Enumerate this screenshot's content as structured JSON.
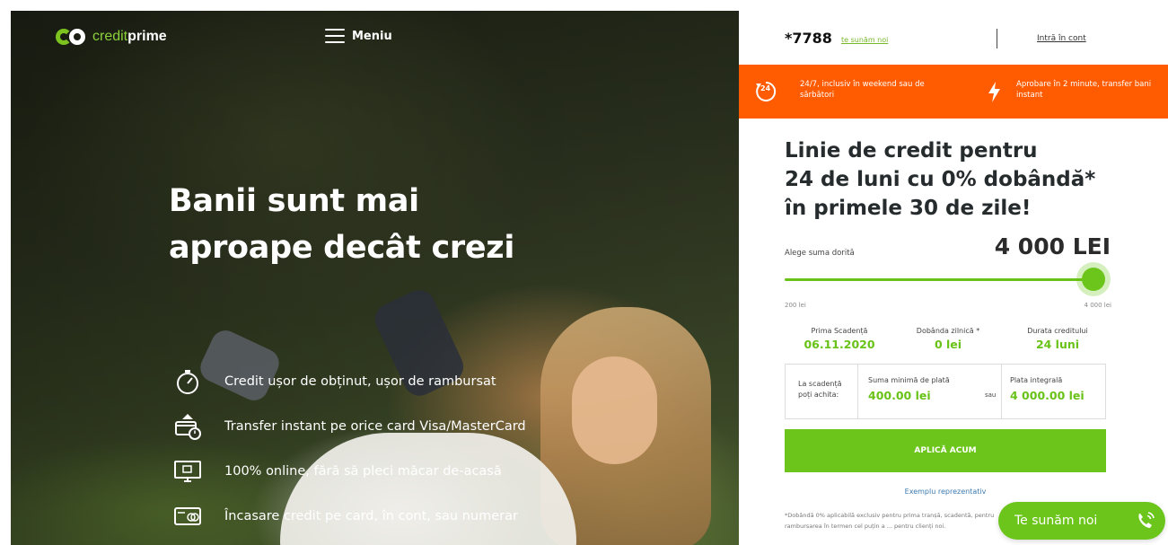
{
  "header": {
    "logo": {
      "credit": "credit",
      "prime": "prime"
    },
    "menu_label": "Meniu"
  },
  "hero": {
    "headline_line1": "Banii sunt mai",
    "headline_line2": "aproape decât crezi",
    "features": [
      {
        "icon": "stopwatch-icon",
        "text": "Credit ușor de obținut, ușor de rambursat"
      },
      {
        "icon": "card-transfer-icon",
        "text": "Transfer instant pe orice card Visa/MasterCard"
      },
      {
        "icon": "monitor-icon",
        "text": "100% online, fără să pleci măcar de-acasă"
      },
      {
        "icon": "cash-card-icon",
        "text": "Încasare credit pe card, în cont, sau numerar"
      }
    ]
  },
  "panel": {
    "phone": "*7788",
    "call_link": "te sunăm noi",
    "login_link": "Intră în cont",
    "banner": {
      "left_text": "24/7, inclusiv în weekend sau de sărbători",
      "right_text": "Aprobare în 2 minute, transfer bani instant",
      "left_icon": "clock-24-icon",
      "right_icon": "lightning-icon"
    },
    "offer_title_line1": "Linie de credit pentru",
    "offer_title_line2": "24 de luni cu 0% dobândă*",
    "offer_title_line3": "în primele 30 de zile!",
    "amount_label": "Alege suma dorită",
    "amount_value": "4 000 LEI",
    "slider": {
      "min_label": "200 lei",
      "max_label": "4 000 lei",
      "min": 200,
      "max": 4000,
      "value": 4000
    },
    "stats": [
      {
        "label": "Prima Scadență",
        "value": "06.11.2020"
      },
      {
        "label": "Dobânda zilnică *",
        "value": "0 lei"
      },
      {
        "label": "Durata creditului",
        "value": "24 luni"
      }
    ],
    "payment": {
      "label_line1": "La scadență",
      "label_line2": "poți achita:",
      "min_label": "Suma minimă de plată",
      "min_value": "400.00 lei",
      "or": "sau",
      "full_label": "Plata integrală",
      "full_value": "4 000.00 lei"
    },
    "apply_label": "APLICĂ ACUM",
    "example_link": "Exemplu reprezentativ",
    "disclaimer": "*Dobândă 0% aplicabilă exclusiv pentru prima tranșă, scadentă, pentru rambursarea în termen cel puțin a ... pentru clienți noi.",
    "callback_label": "Te sunăm noi"
  },
  "colors": {
    "brand_green": "#6cc51a",
    "banner_orange": "#ff5b00",
    "link_blue": "#3b7ab0"
  }
}
